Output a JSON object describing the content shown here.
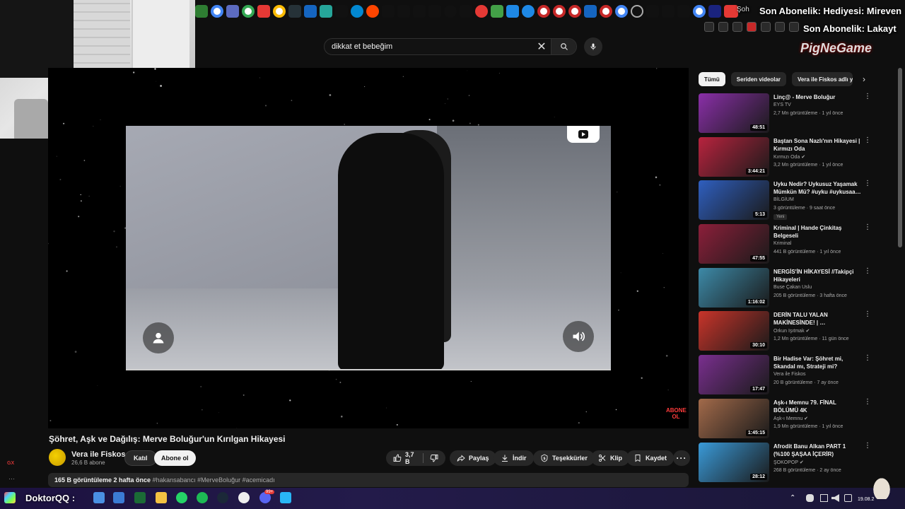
{
  "overlay": {
    "donation_text": "Son Abonelik: Hediyesi: Mireven",
    "sub_text": "Son Abonelik: Lakayt",
    "logo_text": "PigNeGame",
    "notif_text": "Şoh"
  },
  "search": {
    "query": "dikkat et bebeğim"
  },
  "player": {
    "abone_badge": "ABONE OL"
  },
  "video": {
    "title": "Şöhret, Aşk ve Dağılış: Merve Boluğur'un Kırılgan Hikayesi",
    "channel": "Vera ile Fiskos",
    "subscribers": "26,6 B abone",
    "join_label": "Katıl",
    "subscribe_label": "Abone ol",
    "likes": "3,7 B",
    "share_label": "Paylaş",
    "download_label": "İndir",
    "thanks_label": "Teşekkürler",
    "clip_label": "Klip",
    "save_label": "Kaydet",
    "views": "165 B görüntüleme",
    "age": "2 hafta önce",
    "tags": "#hakansabancı #MerveBoluğur #acemicadı"
  },
  "chips": {
    "all": "Tümü",
    "series": "Seriden videolar",
    "channel": "Vera ile Fiskos adlı yü"
  },
  "recommendations": [
    {
      "title": "Linç@ - Merve Boluğur",
      "channel": "EYS TV",
      "meta": "2,7 Mn görüntüleme · 1 yıl önce",
      "duration": "48:51",
      "color": "#8a2fa8"
    },
    {
      "title": "Baştan Sona Nazlı'nın Hikayesi | Kırmızı Oda",
      "channel": "Kırmızı Oda ✔",
      "meta": "3,2 Mn görüntüleme · 1 yıl önce",
      "duration": "3:44:21",
      "color": "#b8233e"
    },
    {
      "title": "Uyku Nedir? Uykusuz Yaşamak Mümkün Mü? #uyku #uykusaa…",
      "channel": "BİLGİUM",
      "meta": "3 görüntüleme · 9 saat önce",
      "duration": "5:13",
      "badge": "Yeni",
      "color": "#2f5fbf"
    },
    {
      "title": "Kriminal | Hande Çinkitaş Belgeseli",
      "channel": "Kriminal",
      "meta": "441 B görüntüleme · 1 yıl önce",
      "duration": "47:55",
      "color": "#8c1f3a"
    },
    {
      "title": "NERGİS'İN HİKAYESİ //Takipçi Hikayeleri",
      "channel": "Buse Çakan Uslu",
      "meta": "205 B görüntüleme · 3 hafta önce",
      "duration": "1:16:02",
      "color": "#3d8aa8"
    },
    {
      "title": "DERİN TALU YALAN MAKİNESİNDE! | …",
      "channel": "Orkun Işıtmak ✔",
      "meta": "1,2 Mn görüntüleme · 11 gün önce",
      "duration": "30:10",
      "color": "#c9342a"
    },
    {
      "title": "Bir Hadise Var: Şöhret mi, Skandal mı, Strateji mi?",
      "channel": "Vera ile Fiskos",
      "meta": "20 B görüntüleme · 7 ay önce",
      "duration": "17:47",
      "color": "#7a2f8f"
    },
    {
      "title": "Aşk-ı Memnu 79. FİNAL BÖLÜMÜ 4K",
      "channel": "Aşk-ı Memnu ✔",
      "meta": "1,9 Mn görüntüleme · 1 yıl önce",
      "duration": "1:45:15",
      "color": "#a26a4a"
    },
    {
      "title": "Afrodit Banu Alkan PART 1 (%100 ŞAŞAA İÇERİR)",
      "channel": "ŞOKOPOP ✔",
      "meta": "268 B görüntüleme · 2 ay önce",
      "duration": "28:12",
      "color": "#3a9ad8"
    }
  ],
  "left": {
    "gx": "GX",
    "dots": "···"
  },
  "taskbar": {
    "user": "DoktorQQ :",
    "badge": "99+",
    "clock": "19.08.2"
  },
  "colors": {
    "background": "#0f0f0f",
    "accent": "#ff0000",
    "taskbar": "#231b4a"
  }
}
